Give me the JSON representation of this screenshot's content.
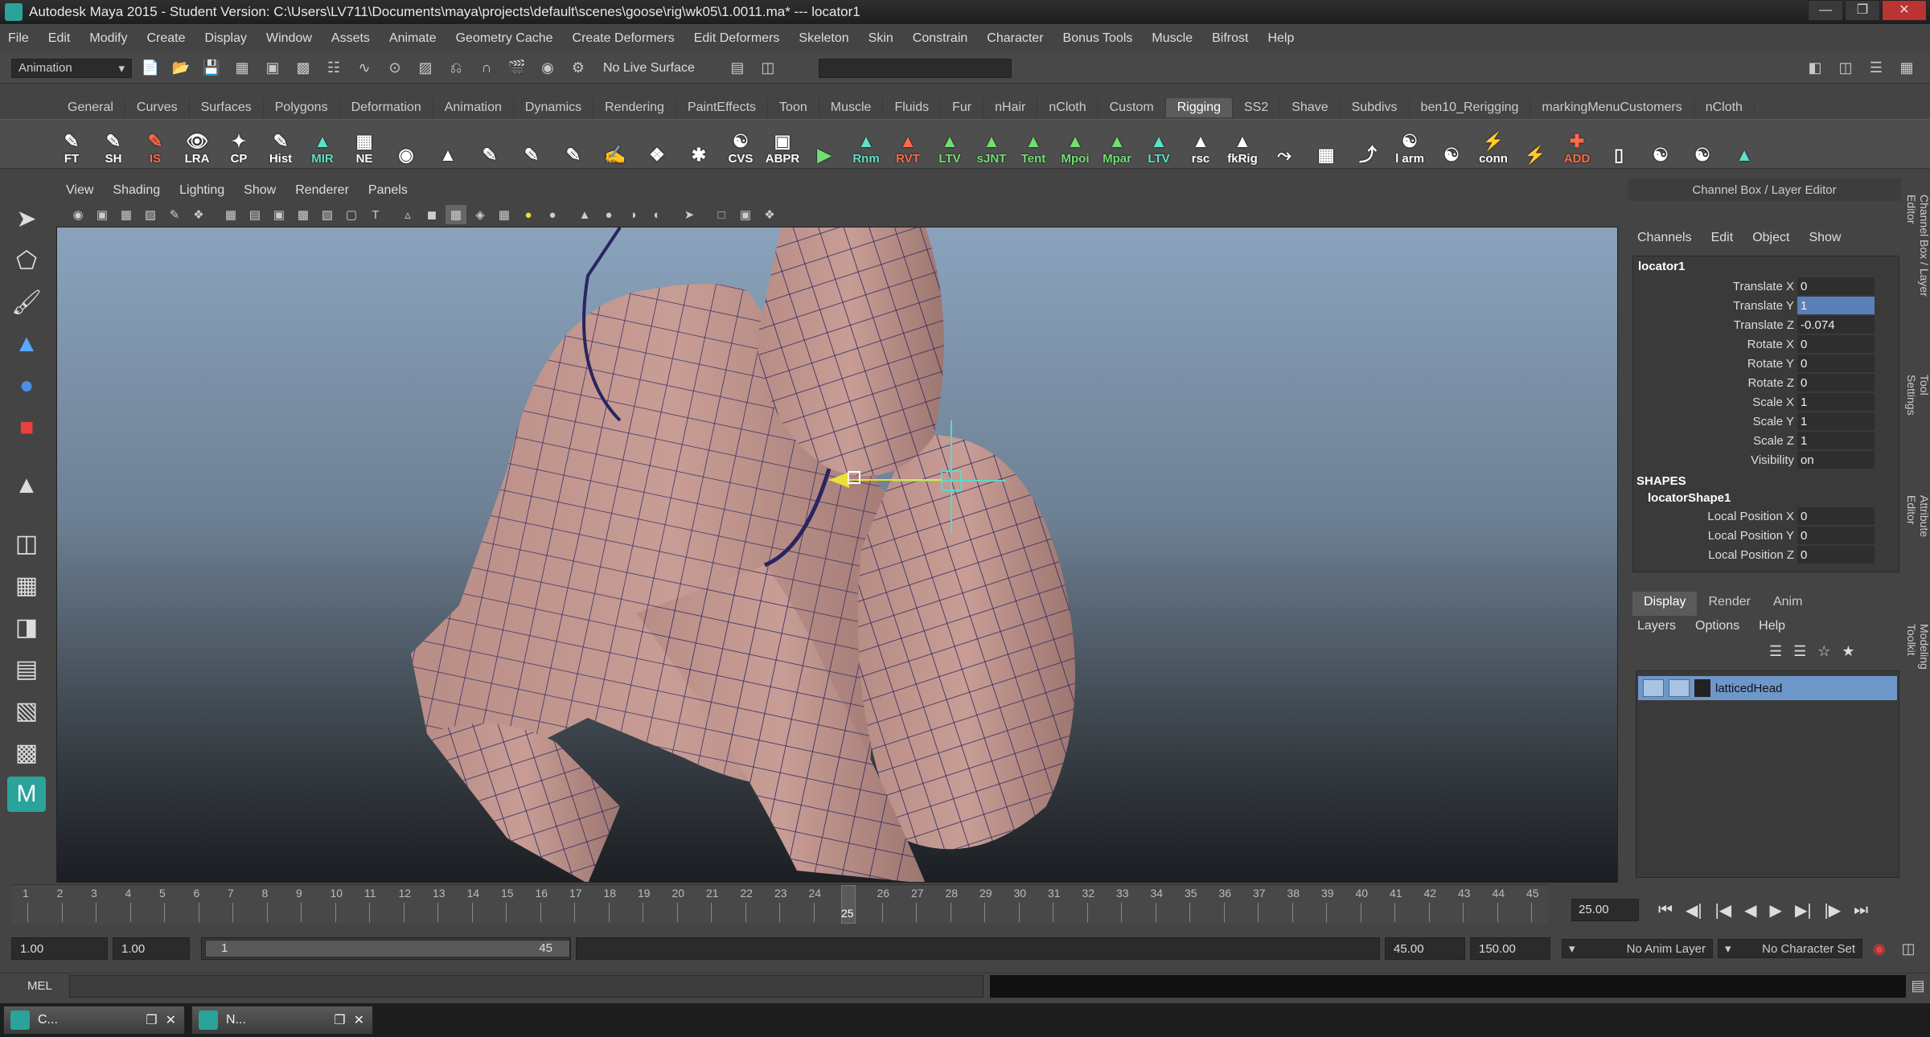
{
  "window": {
    "title": "Autodesk Maya 2015 - Student Version: C:\\Users\\LV711\\Documents\\maya\\projects\\default\\scenes\\goose\\rig\\wk05\\1.0011.ma*   ---   locator1"
  },
  "menubar": [
    "File",
    "Edit",
    "Modify",
    "Create",
    "Display",
    "Window",
    "Assets",
    "Animate",
    "Geometry Cache",
    "Create Deformers",
    "Edit Deformers",
    "Skeleton",
    "Skin",
    "Constrain",
    "Character",
    "Bonus Tools",
    "Muscle",
    "Bifrost",
    "Help"
  ],
  "status": {
    "menuset": "Animation",
    "live_surface": "No Live Surface"
  },
  "shelf_tabs": [
    "General",
    "Curves",
    "Surfaces",
    "Polygons",
    "Deformation",
    "Animation",
    "Dynamics",
    "Rendering",
    "PaintEffects",
    "Toon",
    "Muscle",
    "Fluids",
    "Fur",
    "nHair",
    "nCloth",
    "Custom",
    "Rigging",
    "SS2",
    "Shave",
    "Subdivs",
    "ben10_Rerigging",
    "markingMenuCustomers",
    "nCloth"
  ],
  "shelf_active": "Rigging",
  "shelf_buttons": [
    {
      "label": "FT",
      "color": "white"
    },
    {
      "label": "SH",
      "color": "white"
    },
    {
      "label": "IS",
      "color": "red"
    },
    {
      "label": "LRA",
      "color": "white"
    },
    {
      "label": "CP",
      "color": "white"
    },
    {
      "label": "Hist",
      "color": "white"
    },
    {
      "label": "MIR",
      "color": "teal"
    },
    {
      "label": "NE",
      "color": "white"
    },
    {
      "label": "",
      "color": "white"
    },
    {
      "label": "",
      "color": "white"
    },
    {
      "label": "",
      "color": "white"
    },
    {
      "label": "",
      "color": "white"
    },
    {
      "label": "",
      "color": "white"
    },
    {
      "label": "",
      "color": "white"
    },
    {
      "label": "",
      "color": "white"
    },
    {
      "label": "",
      "color": "white"
    },
    {
      "label": "CVS",
      "color": "white"
    },
    {
      "label": "ABPR",
      "color": "white"
    },
    {
      "label": "",
      "color": "green"
    },
    {
      "label": "Rnm",
      "color": "teal"
    },
    {
      "label": "RVT",
      "color": "red"
    },
    {
      "label": "LTV",
      "color": "green"
    },
    {
      "label": "sJNT",
      "color": "green"
    },
    {
      "label": "Tent",
      "color": "green"
    },
    {
      "label": "Mpoi",
      "color": "green"
    },
    {
      "label": "Mpar",
      "color": "green"
    },
    {
      "label": "LTV",
      "color": "teal"
    },
    {
      "label": "rsc",
      "color": "white"
    },
    {
      "label": "fkRig",
      "color": "white"
    },
    {
      "label": "",
      "color": "white"
    },
    {
      "label": "",
      "color": "white"
    },
    {
      "label": "",
      "color": "white"
    },
    {
      "label": "l arm",
      "color": "white"
    },
    {
      "label": "",
      "color": "white"
    },
    {
      "label": "conn",
      "color": "white"
    },
    {
      "label": "",
      "color": "white"
    },
    {
      "label": "ADD",
      "color": "red"
    },
    {
      "label": "",
      "color": "white"
    },
    {
      "label": "",
      "color": "white"
    },
    {
      "label": "",
      "color": "white"
    },
    {
      "label": "",
      "color": "teal"
    }
  ],
  "panel_menu": [
    "View",
    "Shading",
    "Lighting",
    "Show",
    "Renderer",
    "Panels"
  ],
  "channel_box": {
    "header": "Channel Box / Layer Editor",
    "menu": [
      "Channels",
      "Edit",
      "Object",
      "Show"
    ],
    "object": "locator1",
    "attrs": [
      {
        "name": "Translate X",
        "value": "0"
      },
      {
        "name": "Translate Y",
        "value": "1"
      },
      {
        "name": "Translate Z",
        "value": "-0.074"
      },
      {
        "name": "Rotate X",
        "value": "0"
      },
      {
        "name": "Rotate Y",
        "value": "0"
      },
      {
        "name": "Rotate Z",
        "value": "0"
      },
      {
        "name": "Scale X",
        "value": "1"
      },
      {
        "name": "Scale Y",
        "value": "1"
      },
      {
        "name": "Scale Z",
        "value": "1"
      },
      {
        "name": "Visibility",
        "value": "on"
      }
    ],
    "shapes_label": "SHAPES",
    "shape_name": "locatorShape1",
    "shape_attrs": [
      {
        "name": "Local Position X",
        "value": "0"
      },
      {
        "name": "Local Position Y",
        "value": "0"
      },
      {
        "name": "Local Position Z",
        "value": "0"
      }
    ]
  },
  "side_tabs": [
    "Channel Box / Layer Editor",
    "Tool Settings",
    "Attribute Editor",
    "Modeling Toolkit"
  ],
  "layer_editor": {
    "tabs": [
      "Display",
      "Render",
      "Anim"
    ],
    "menu": [
      "Layers",
      "Options",
      "Help"
    ],
    "layer": "latticedHead"
  },
  "timeline": {
    "ticks": [
      "1",
      "2",
      "3",
      "4",
      "5",
      "6",
      "7",
      "8",
      "9",
      "10",
      "11",
      "12",
      "13",
      "14",
      "15",
      "16",
      "17",
      "18",
      "19",
      "20",
      "21",
      "22",
      "23",
      "24",
      "25",
      "26",
      "27",
      "28",
      "29",
      "30",
      "31",
      "32",
      "33",
      "34",
      "35",
      "36",
      "37",
      "38",
      "39",
      "40",
      "41",
      "42",
      "43",
      "44",
      "45"
    ],
    "current": "25",
    "current_field": "25.00"
  },
  "range": {
    "start": "1.00",
    "start2": "1.00",
    "slider_start": "1",
    "slider_end": "45",
    "end": "45.00",
    "end2": "150.00",
    "anim_layer": "No Anim Layer",
    "char_set": "No Character Set"
  },
  "cmd": {
    "label": "MEL"
  },
  "taskbar": [
    {
      "label": "C..."
    },
    {
      "label": "N..."
    }
  ]
}
